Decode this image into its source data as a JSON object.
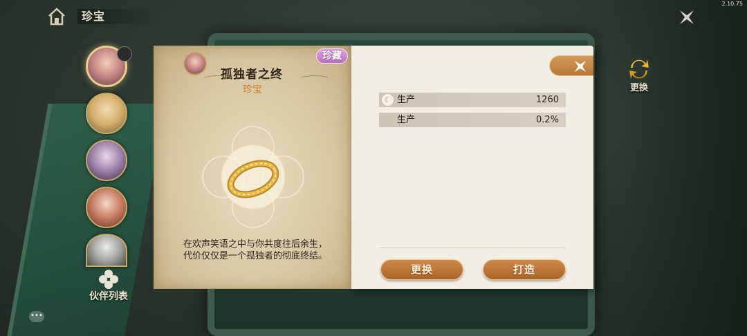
{
  "version": "2.10.75",
  "header": {
    "title": "珍宝",
    "home_icon": "home-icon",
    "close_icon": "close-icon"
  },
  "sidebar": {
    "list_label": "伙伴列表",
    "chat_icon": "chat-icon",
    "avatars": [
      {
        "name": "partner-avatar-1",
        "selected": true
      },
      {
        "name": "partner-avatar-2",
        "selected": false
      },
      {
        "name": "partner-avatar-3",
        "selected": false
      },
      {
        "name": "partner-avatar-4",
        "selected": false
      },
      {
        "name": "partner-avatar-5",
        "selected": false
      }
    ]
  },
  "side_action": {
    "replace_label": "更换",
    "icon": "refresh-icon"
  },
  "item": {
    "name": "孤独者之终",
    "type": "珍宝",
    "rarity": "珍藏",
    "rarity_color": "#c27ccb",
    "description": "在欢声笑语之中与你共度往后余生，代价仅仅是一个孤独者的彻底终结。",
    "icon": "ring-image"
  },
  "attributes": [
    {
      "label": "生产",
      "value": "1260",
      "icon": "attribute-icon"
    },
    {
      "label": "生产",
      "value": "0.2%",
      "icon": ""
    }
  ],
  "actions": {
    "replace": "更换",
    "forge": "打造"
  },
  "colors": {
    "accent_button": "#b8783a",
    "item_type": "#c97a2a",
    "panel_bg": "#f3eee4"
  }
}
